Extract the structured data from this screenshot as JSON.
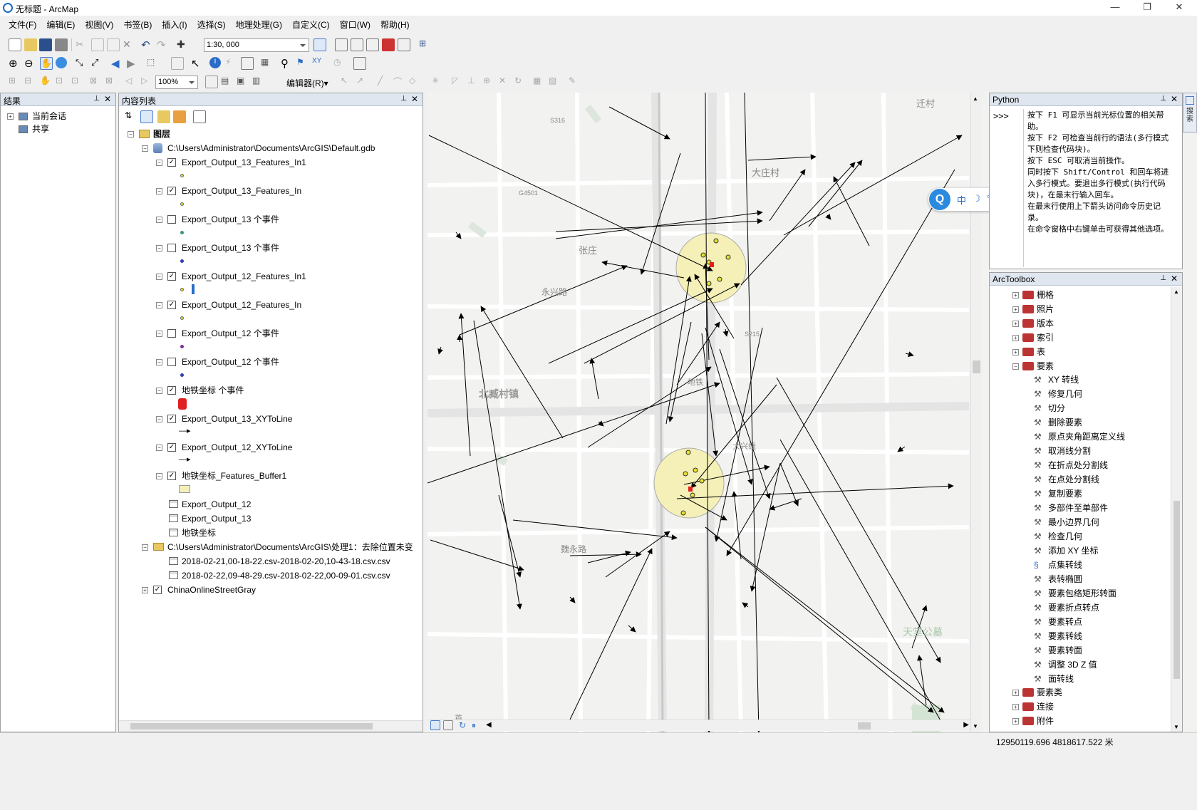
{
  "window": {
    "title": "无标题 - ArcMap",
    "minimize": "—",
    "maximize": "❐",
    "close": "✕"
  },
  "menubar": [
    "文件(F)",
    "编辑(E)",
    "视图(V)",
    "书签(B)",
    "插入(I)",
    "选择(S)",
    "地理处理(G)",
    "自定义(C)",
    "窗口(W)",
    "帮助(H)"
  ],
  "toolbar": {
    "scale": "1:30, 000",
    "zoom_percent": "100%",
    "editor_label": "编辑器(R)▾"
  },
  "results_panel": {
    "title": "结果",
    "items": [
      "当前会话",
      "共享"
    ]
  },
  "toc_panel": {
    "title": "内容列表",
    "root": "图层",
    "gdb_path": "C:\\Users\\Administrator\\Documents\\ArcGIS\\Default.gdb",
    "layers": [
      {
        "name": "Export_Output_13_Features_In1",
        "checked": true
      },
      {
        "name": "Export_Output_13_Features_In",
        "checked": true
      },
      {
        "name": "Export_Output_13 个事件",
        "checked": false
      },
      {
        "name": "Export_Output_13 个事件",
        "checked": false
      },
      {
        "name": "Export_Output_12_Features_In1",
        "checked": true
      },
      {
        "name": "Export_Output_12_Features_In",
        "checked": true
      },
      {
        "name": "Export_Output_12 个事件",
        "checked": false
      },
      {
        "name": "Export_Output_12 个事件",
        "checked": false
      },
      {
        "name": "地铁坐标 个事件",
        "checked": true
      },
      {
        "name": "Export_Output_13_XYToLine",
        "checked": true
      },
      {
        "name": "Export_Output_12_XYToLine",
        "checked": true
      },
      {
        "name": "地铁坐标_Features_Buffer1",
        "checked": true
      }
    ],
    "tables": [
      "Export_Output_12",
      "Export_Output_13",
      "地铁坐标"
    ],
    "folder_path": "C:\\Users\\Administrator\\Documents\\ArcGIS\\处理1：去除位置未变",
    "csv_files": [
      "2018-02-21,00-18-22.csv-2018-02-20,10-43-18.csv.csv",
      "2018-02-22,09-48-29.csv-2018-02-22,00-09-01.csv.csv"
    ],
    "basemap": "ChinaOnlineStreetGray",
    "basemap_checked": true
  },
  "map": {
    "labels": [
      "迁村",
      "大庄村",
      "张庄",
      "永兴路",
      "北臧村镇",
      "天堂公墓",
      "魏永路",
      "S316",
      "G4501",
      "S215",
      "地铁",
      "大兴线",
      "芦"
    ]
  },
  "ime_bar": {
    "items": [
      "中",
      "☽",
      "°,",
      "✎",
      "▤",
      "☺"
    ]
  },
  "python_panel": {
    "title": "Python",
    "prompt": ">>>",
    "help_lines": [
      "按下 F1 可显示当前光标位置的相关帮助。",
      "按下 F2 可检查当前行的语法(多行模式下则检查代码块)。",
      "按下 ESC 可取消当前操作。",
      "同时按下 Shift/Control 和回车将进入多行模式。要退出多行模式(执行代码块)，在最末行输入回车。",
      "在最末行使用上下箭头访问命令历史记录。",
      "在命令窗格中右键单击可获得其他选项。"
    ]
  },
  "toolbox_panel": {
    "title": "ArcToolbox",
    "toolsets_top": [
      "栅格",
      "照片",
      "版本",
      "索引",
      "表",
      "要素"
    ],
    "tools": [
      "XY 转线",
      "修复几何",
      "切分",
      "删除要素",
      "原点夹角距离定义线",
      "取消线分割",
      "在折点处分割线",
      "在点处分割线",
      "复制要素",
      "多部件至单部件",
      "最小边界几何",
      "检查几何",
      "添加 XY 坐标",
      "点集转线",
      "表转椭圆",
      "要素包络矩形转面",
      "要素折点转点",
      "要素转点",
      "要素转线",
      "要素转面",
      "调整 3D Z 值",
      "面转线"
    ],
    "toolsets_bottom": [
      "要素类",
      "连接",
      "附件"
    ]
  },
  "side_tab": "搜索",
  "status": {
    "coords": "12950119.696  4818617.522 米"
  }
}
